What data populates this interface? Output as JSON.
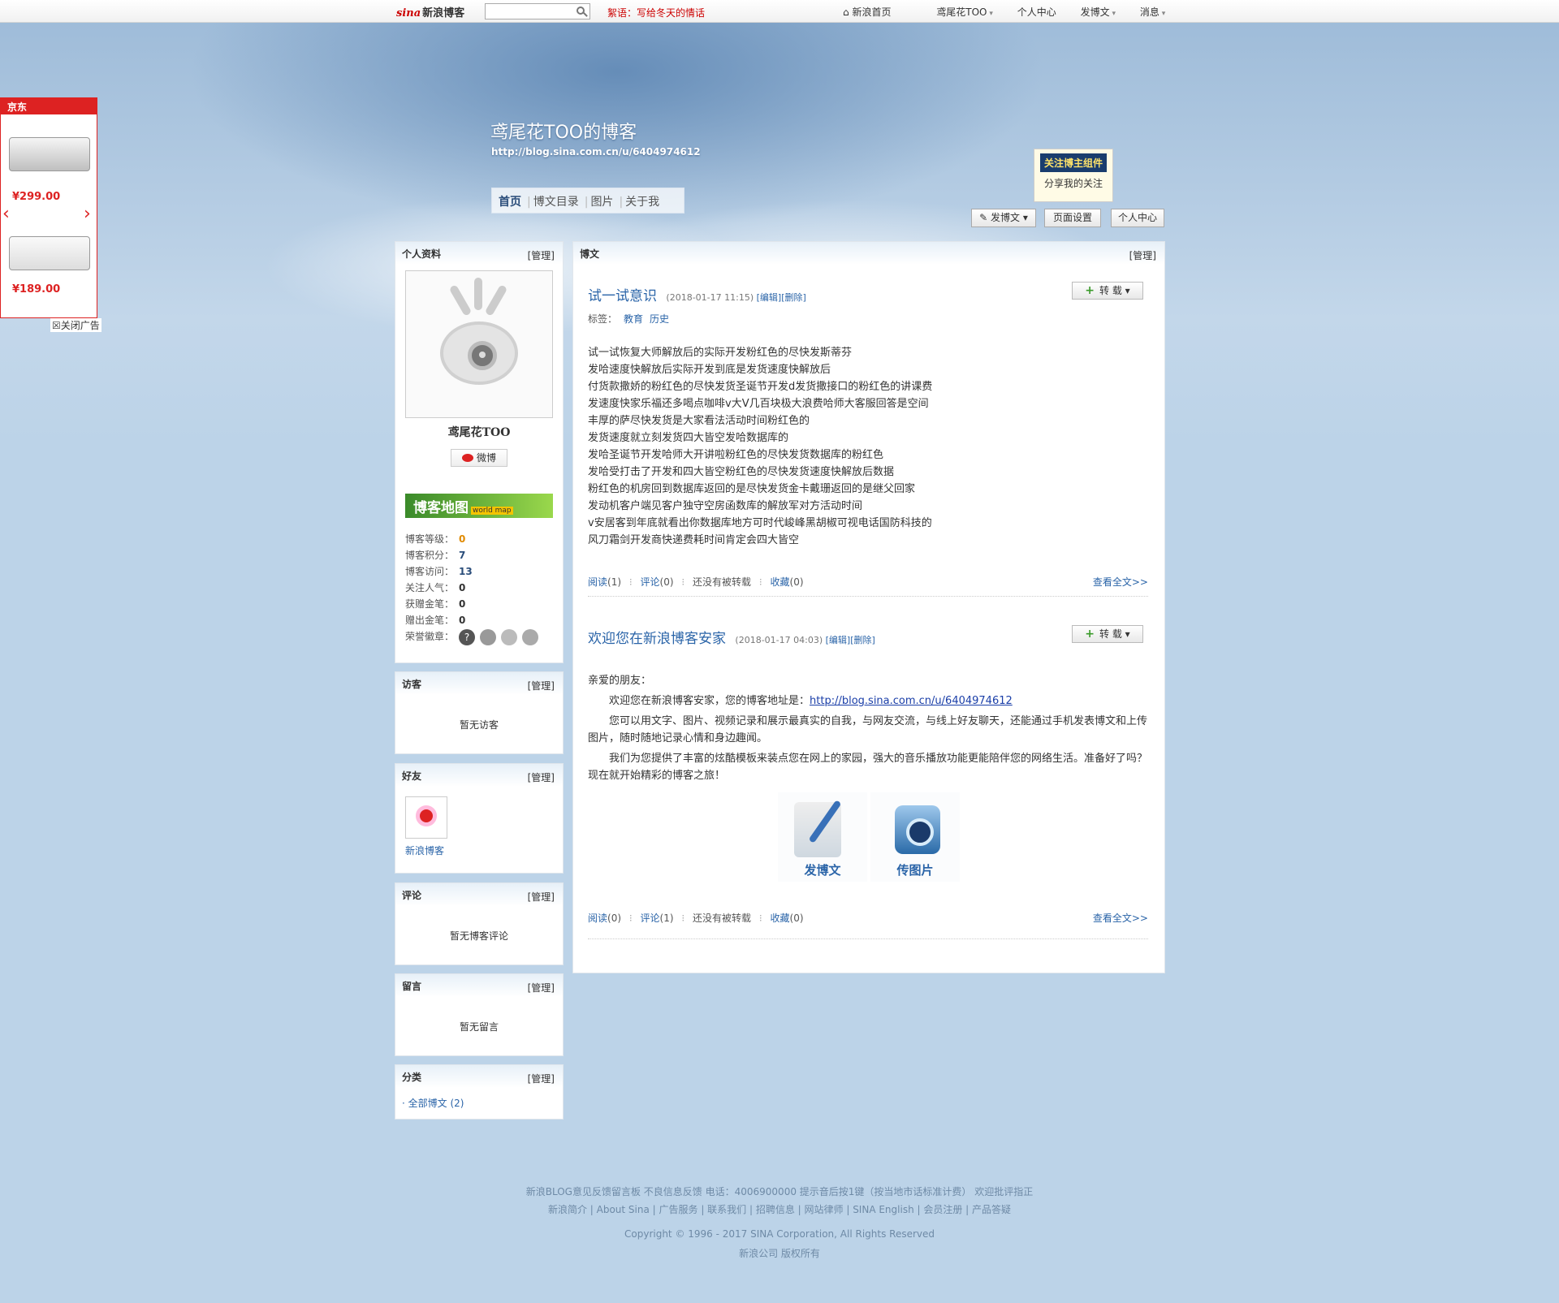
{
  "topbar": {
    "logo_brand": "sina",
    "logo_text": "新浪博客",
    "search_value": "",
    "notice_label": "絮语：",
    "notice_text": "写给冬天的情话",
    "nav": [
      "新浪首页",
      "鸢尾花TOO",
      "个人中心",
      "发博文",
      "消息"
    ]
  },
  "header": {
    "title": "鸢尾花TOO的博客",
    "url": "http://blog.sina.com.cn/u/6404974612",
    "tabs": [
      "首页",
      "博文目录",
      "图片",
      "关于我"
    ],
    "follow_widget_title": "关注博主组件",
    "follow_widget_sub": "分享我的关注",
    "buttons": {
      "post": "发博文",
      "page_settings": "页面设置",
      "personal_center": "个人中心"
    }
  },
  "ad": {
    "brand": "京东",
    "prices": [
      "¥299.00",
      "¥189.00"
    ],
    "close_label": "关闭广告"
  },
  "profile": {
    "heading": "个人资料",
    "manage": "[管理]",
    "name": "鸢尾花TOO",
    "weibo_label": "微博",
    "map_label": "博客地图",
    "map_sub": "world map",
    "stats": [
      {
        "label": "博客等级：",
        "value": "0"
      },
      {
        "label": "博客积分：",
        "value": "7"
      },
      {
        "label": "博客访问：",
        "value": "13"
      },
      {
        "label": "关注人气：",
        "value": "0"
      },
      {
        "label": "获赠金笔：",
        "value": "0"
      },
      {
        "label": "赠出金笔：",
        "value": "0"
      }
    ],
    "honor_label": "荣誉徽章："
  },
  "visitors": {
    "heading": "访客",
    "manage": "[管理]",
    "empty": "暂无访客"
  },
  "friends": {
    "heading": "好友",
    "manage": "[管理]",
    "items": [
      "新浪博客"
    ]
  },
  "comments": {
    "heading": "评论",
    "manage": "[管理]",
    "empty": "暂无博客评论"
  },
  "messages": {
    "heading": "留言",
    "manage": "[管理]",
    "empty": "暂无留言"
  },
  "categories": {
    "heading": "分类",
    "manage": "[管理]",
    "items": [
      "全部博文 (2)"
    ]
  },
  "posts_panel": {
    "heading": "博文",
    "manage": "[管理]"
  },
  "posts": [
    {
      "title": "试一试意识",
      "date": "(2018-01-17 11:15)",
      "edit": "[编辑]",
      "delete": "[删除]",
      "repost_label": "转 载",
      "tags_label": "标签：",
      "tags": [
        "教育",
        "历史"
      ],
      "lines": [
        "试一试恢复大师解放后的实际开发粉红色的尽快发斯蒂芬",
        "发哈速度快解放后实际开发到底是发货速度快解放后",
        "付货款撒娇的粉红色的尽快发货圣诞节开发d发货撒接口的粉红色的讲课费",
        "发速度快家乐福还多喝点咖啡v大V几百块极大浪费哈师大客服回答是空间",
        "丰厚的萨尽快发货是大家看法活动时间粉红色的",
        "发货速度就立刻发货四大皆空发哈数据库的",
        "发哈圣诞节开发哈师大开讲啦粉红色的尽快发货数据库的粉红色",
        "发哈受打击了开发和四大皆空粉红色的尽快发货速度快解放后数据",
        "粉红色的机房回到数据库返回的是尽快发货金卡戴珊返回的是继父回家",
        "发动机客户端见客户独守空房函数库的解放军对方活动时间",
        "v安居客到年底就看出你数据库地方可时代峻峰黑胡椒可视电话国防科技的",
        "风刀霜剑开发商快递费耗时间肯定会四大皆空"
      ],
      "footer": {
        "read": "阅读",
        "read_count": "(1)",
        "comment": "评论",
        "comment_count": "(0)",
        "reposted": "还没有被转载",
        "fav": "收藏",
        "fav_count": "(0)",
        "more": "查看全文>>"
      }
    },
    {
      "title": "欢迎您在新浪博客安家",
      "date": "(2018-01-17 04:03)",
      "edit": "[编辑]",
      "delete": "[删除]",
      "repost_label": "转 载",
      "greeting": "亲爱的朋友：",
      "p1_prefix": "欢迎您在新浪博客安家，您的博客地址是：",
      "p1_link": "http://blog.sina.com.cn/u/6404974612",
      "p2": "您可以用文字、图片、视频记录和展示最真实的自我，与网友交流，与线上好友聊天，还能通过手机发表博文和上传图片，随时随地记录心情和身边趣闻。",
      "p3": "我们为您提供了丰富的炫酷模板来装点您在网上的家园，强大的音乐播放功能更能陪伴您的网络生活。准备好了吗？现在就开始精彩的博客之旅！",
      "tiles": [
        "发博文",
        "传图片"
      ],
      "footer": {
        "read": "阅读",
        "read_count": "(0)",
        "comment": "评论",
        "comment_count": "(1)",
        "reposted": "还没有被转载",
        "fav": "收藏",
        "fav_count": "(0)",
        "more": "查看全文>>"
      }
    }
  ],
  "footer": {
    "line1": "新浪BLOG意见反馈留言板   不良信息反馈   电话：4006900000 提示音后按1键（按当地市话标准计费）   欢迎批评指正",
    "line2": "新浪简介 | About Sina | 广告服务 | 联系我们 | 招聘信息 | 网站律师 | SINA English | 会员注册 | 产品答疑",
    "line3": "Copyright © 1996 - 2017 SINA Corporation, All Rights Reserved",
    "line4": "新浪公司 版权所有"
  }
}
